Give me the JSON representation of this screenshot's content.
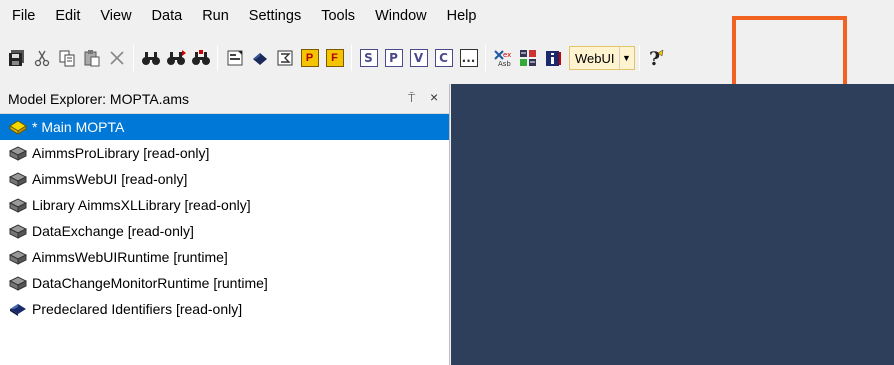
{
  "menubar": {
    "items": [
      "File",
      "Edit",
      "View",
      "Data",
      "Run",
      "Settings",
      "Tools",
      "Window",
      "Help"
    ]
  },
  "toolbar": {
    "buttons": [
      {
        "icon": "save-all-icon"
      },
      {
        "icon": "cut-icon"
      },
      {
        "icon": "copy-icon"
      },
      {
        "icon": "paste-icon"
      },
      {
        "icon": "delete-icon"
      },
      {
        "icon": "find-icon"
      },
      {
        "icon": "find-next-icon"
      },
      {
        "icon": "find-in-project-icon"
      },
      {
        "icon": "properties-icon"
      },
      {
        "icon": "model-explorer-icon"
      },
      {
        "icon": "identifier-selector-icon"
      },
      {
        "icon": "page-manager-icon",
        "label": "P"
      },
      {
        "icon": "template-manager-icon",
        "label": "F"
      },
      {
        "icon": "s-icon",
        "label": "S"
      },
      {
        "icon": "p-icon",
        "label": "P"
      },
      {
        "icon": "v-icon",
        "label": "V"
      },
      {
        "icon": "c-icon",
        "label": "C"
      },
      {
        "icon": "more-icon",
        "label": "..."
      },
      {
        "icon": "data-manager-icon"
      },
      {
        "icon": "case-icon"
      },
      {
        "icon": "info-icon"
      },
      {
        "icon": "help-icon"
      }
    ],
    "webui_combo": {
      "value": "WebUI"
    }
  },
  "colors": {
    "selection": "#0078d7",
    "workspace": "#2e3f5c",
    "highlight": "#f26322",
    "combo_bg": "#fff4cf"
  },
  "explorer": {
    "title": "Model Explorer: MOPTA.ams",
    "pin_glyph": "⍑",
    "close_glyph": "×",
    "items": [
      {
        "label": "* Main MOPTA",
        "icon": "main-model-icon",
        "selected": true
      },
      {
        "label": "AimmsProLibrary [read-only]",
        "icon": "library-icon"
      },
      {
        "label": "AimmsWebUI [read-only]",
        "icon": "library-icon"
      },
      {
        "label": "Library AimmsXLLibrary [read-only]",
        "icon": "library-icon"
      },
      {
        "label": "DataExchange [read-only]",
        "icon": "library-icon"
      },
      {
        "label": "AimmsWebUIRuntime [runtime]",
        "icon": "library-icon"
      },
      {
        "label": "DataChangeMonitorRuntime [runtime]",
        "icon": "library-icon"
      },
      {
        "label": "Predeclared Identifiers [read-only]",
        "icon": "predeclared-book-icon"
      }
    ]
  }
}
